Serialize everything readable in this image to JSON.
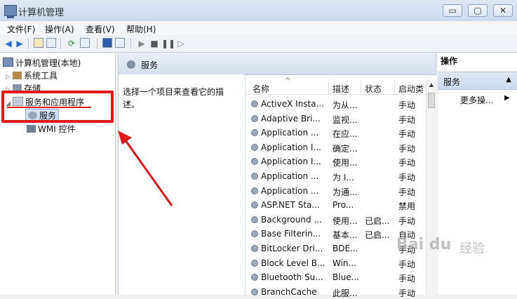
{
  "window": {
    "title": "计算机管理",
    "min": "▭",
    "max": "▢",
    "close": "✕"
  },
  "menu": [
    "文件(F)",
    "操作(A)",
    "查看(V)",
    "帮助(H)"
  ],
  "tree": {
    "root": "计算机管理(本地)",
    "system_tools": "系统工具",
    "storage": "存储",
    "services_apps": "服务和应用程序",
    "services": "服务",
    "wmi": "WMI 控件"
  },
  "middle": {
    "header": "服务",
    "description": "选择一个项目来查看它的描述。",
    "columns": {
      "name": "名称",
      "desc": "描述",
      "status": "状态",
      "startup": "启动类"
    },
    "rows": [
      {
        "name": "ActiveX Insta...",
        "desc": "为从...",
        "status": "",
        "startup": "手动"
      },
      {
        "name": "Adaptive Bri...",
        "desc": "监视...",
        "status": "",
        "startup": "手动"
      },
      {
        "name": "Application ...",
        "desc": "在应...",
        "status": "",
        "startup": "手动"
      },
      {
        "name": "Application I...",
        "desc": "确定...",
        "status": "",
        "startup": "手动"
      },
      {
        "name": "Application I...",
        "desc": "使用...",
        "status": "",
        "startup": "手动"
      },
      {
        "name": "Application ...",
        "desc": "为 I...",
        "status": "",
        "startup": "手动"
      },
      {
        "name": "Application ...",
        "desc": "为通...",
        "status": "",
        "startup": "手动"
      },
      {
        "name": "ASP.NET Sta...",
        "desc": "Pro...",
        "status": "",
        "startup": "禁用"
      },
      {
        "name": "Background ...",
        "desc": "使用...",
        "status": "已启...",
        "startup": "手动"
      },
      {
        "name": "Base Filterin...",
        "desc": "基本...",
        "status": "已启...",
        "startup": "自动"
      },
      {
        "name": "BitLocker Dri...",
        "desc": "BDE...",
        "status": "",
        "startup": "手动"
      },
      {
        "name": "Block Level B...",
        "desc": "Win...",
        "status": "",
        "startup": "手动"
      },
      {
        "name": "Bluetooth Su...",
        "desc": "Blue...",
        "status": "",
        "startup": "手动"
      },
      {
        "name": "BranchCache",
        "desc": "此服...",
        "status": "",
        "startup": "手动"
      }
    ]
  },
  "actions": {
    "title": "操作",
    "section": "服务",
    "more": "更多操..."
  },
  "watermark": {
    "brand": "Bai du",
    "suffix": "经验"
  }
}
